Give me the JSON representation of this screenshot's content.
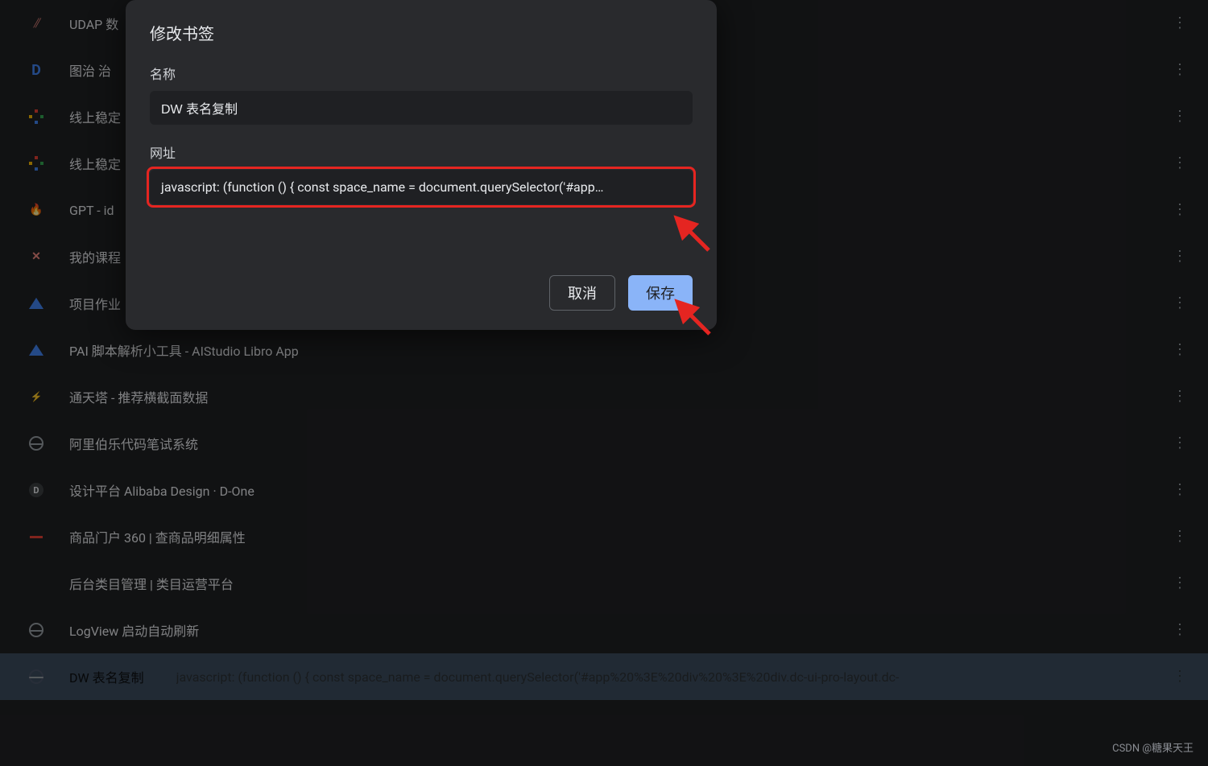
{
  "dialog": {
    "title": "修改书签",
    "name_label": "名称",
    "name_value": "DW 表名复制",
    "url_label": "网址",
    "url_value": "javascript: (function () {  const space_name = document.querySelector('#app…",
    "cancel": "取消",
    "save": "保存"
  },
  "bookmarks": [
    {
      "title": "UDAP 数",
      "icon": "udap"
    },
    {
      "title": "图治 治",
      "icon": "d-letter"
    },
    {
      "title": "线上稳定",
      "icon": "plus-multi"
    },
    {
      "title": "线上稳定",
      "icon": "plus-multi"
    },
    {
      "title": "GPT - id",
      "icon": "fire"
    },
    {
      "title": "我的课程",
      "icon": "x-cross"
    },
    {
      "title": "项目作业",
      "icon": "tri-a"
    },
    {
      "title": "PAI 脚本解析小工具 - AIStudio Libro App",
      "icon": "tri-a"
    },
    {
      "title": "通天塔 - 推荐横截面数据",
      "icon": "bolt"
    },
    {
      "title": "阿里伯乐代码笔试系统",
      "icon": "globe"
    },
    {
      "title": "设计平台 Alibaba Design · D-One",
      "icon": "d-circ"
    },
    {
      "title": "商品门户 360 | 查商品明细属性",
      "icon": "dash"
    },
    {
      "title": "后台类目管理  |  类目运营平台",
      "icon": "t-letter"
    },
    {
      "title": "LogView 启动自动刷新",
      "icon": "globe"
    },
    {
      "title": "DW 表名复制",
      "icon": "globe-dark",
      "url": "javascript: (function () { const space_name = document.querySelector('#app%20%3E%20div%20%3E%20div.dc-ui-pro-layout.dc-"
    }
  ],
  "watermark": "CSDN @糖果天王"
}
